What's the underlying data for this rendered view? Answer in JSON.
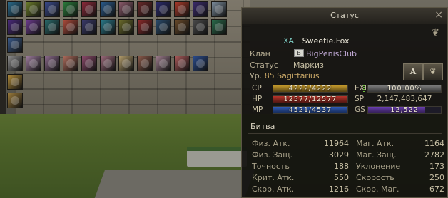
{
  "window": {
    "title": "Статус"
  },
  "character": {
    "tag": "XA",
    "name": "Sweetie.Fox",
    "clan_label": "Клан",
    "clan_icon_text": "B",
    "clan_name": "BigPenisClub",
    "status_label": "Статус",
    "status_value": "Маркиз",
    "level_prefix": "Ур.",
    "level_value": "85 Sagittarius"
  },
  "buttons": {
    "a_label": "A",
    "b_label": "❦"
  },
  "gauges": {
    "cp": {
      "label": "CP",
      "text": "4222/4222",
      "fill": 1.0,
      "color": "#c49a2c"
    },
    "hp": {
      "label": "HP",
      "text": "12577/12577",
      "fill": 1.0,
      "color": "#b8342a"
    },
    "mp": {
      "label": "MP",
      "text": "4521/4537",
      "fill": 0.996,
      "color": "#2f5bb7"
    },
    "exp": {
      "label": "EXP",
      "text": "100.00%",
      "fill": 1.0,
      "color": "#7c7c7c"
    },
    "sp": {
      "label": "SP",
      "text": "2,147,483,647"
    },
    "gs": {
      "label": "GS",
      "text": "12,522",
      "fill": 0.78,
      "color": "#6a3fb0"
    }
  },
  "battle": {
    "title": "Битва",
    "left": [
      {
        "label": "Физ. Атк.",
        "value": "11964"
      },
      {
        "label": "Физ. Защ.",
        "value": "3029"
      },
      {
        "label": "Точность",
        "value": "188"
      },
      {
        "label": "Крит. Атк.",
        "value": "550"
      },
      {
        "label": "Скор. Атк.",
        "value": "1216"
      }
    ],
    "right": [
      {
        "label": "Маг. Атк.",
        "value": "1164"
      },
      {
        "label": "Маг. Защ.",
        "value": "2782"
      },
      {
        "label": "Уклонение",
        "value": "173"
      },
      {
        "label": "Скорость",
        "value": "250"
      },
      {
        "label": "Скор. Маг.",
        "value": "672"
      }
    ]
  },
  "skillbar": {
    "icon_colors": [
      "#2a6a8a",
      "#6a7a2a",
      "#3a4a8a",
      "#2a7a3a",
      "#8a2a3a",
      "#2a5a8a",
      "#8a5a6a",
      "#6a2a2a",
      "#2a2a6a",
      "#aa3a2a",
      "#3a2a6a",
      "#7a8a9a",
      "#4a2a7a",
      "#6a3a8a",
      "#2a6a6a",
      "#aa4a3a",
      "#3a3a6a",
      "#2a7a8a",
      "#6a6a2a",
      "#8a2a2a",
      "#2a4a6a",
      "#6a4a2a",
      "#4a4a4a",
      "#2a6a4a",
      "#3a5a8a",
      "#8a8a8a",
      "#9a7a9a",
      "#8a6a8a",
      "#aa6a5a",
      "#8a4a6a",
      "#9a6a7a",
      "#b09a6a",
      "#8a5a4a",
      "#9a7a8a",
      "#aa5a5a",
      "#2a4a8a",
      "#b08a3a",
      "#9a7a3a"
    ]
  }
}
